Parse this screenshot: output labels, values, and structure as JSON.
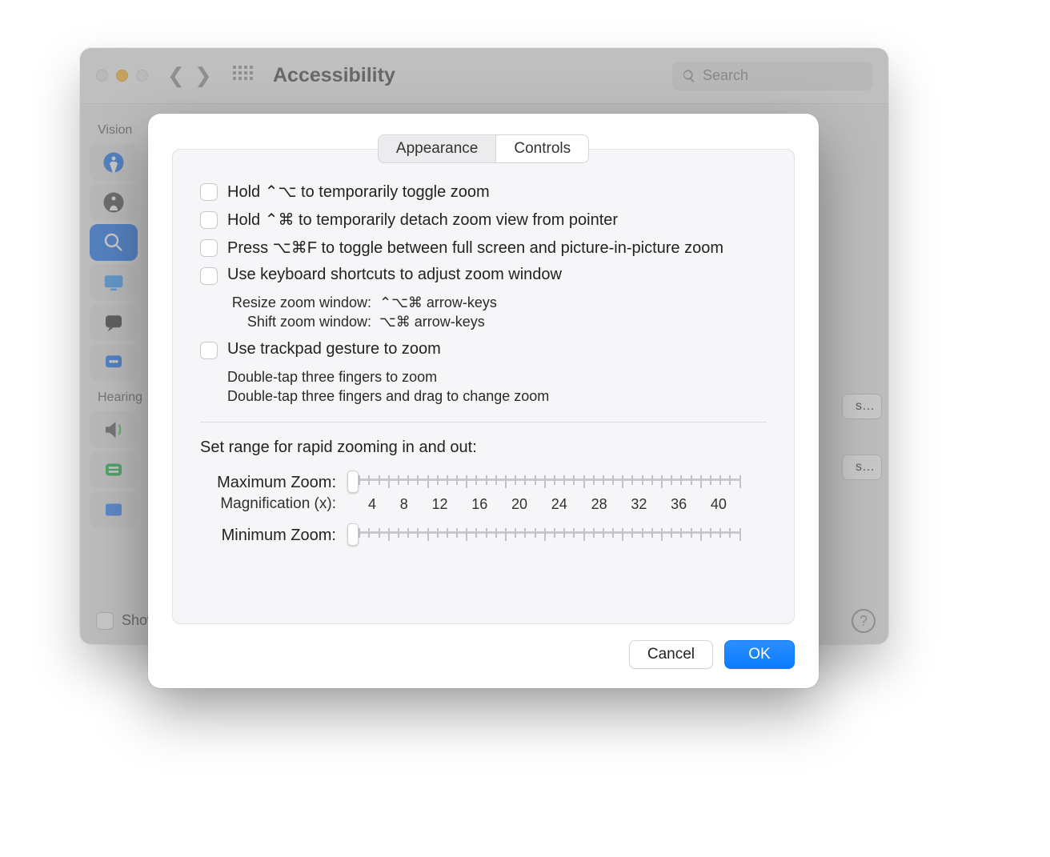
{
  "window": {
    "title": "Accessibility",
    "search_placeholder": "Search"
  },
  "sidebar": {
    "vision_label": "Vision",
    "hearing_label": "Hearing",
    "show_label": "Show"
  },
  "bg_buttons": {
    "ellipsis1": "s…",
    "ellipsis2": "s…"
  },
  "help_label": "?",
  "tabs": {
    "appearance": "Appearance",
    "controls": "Controls"
  },
  "options": {
    "hold_toggle": {
      "label": "Hold ⌃⌥ to temporarily toggle zoom"
    },
    "hold_detach": {
      "label": "Hold ⌃⌘ to temporarily detach zoom view from pointer"
    },
    "press_toggle": {
      "label": "Press ⌥⌘F to toggle between full screen and picture-in-picture zoom"
    },
    "kb_shortcuts": {
      "label": "Use keyboard shortcuts to adjust zoom window",
      "resize_k": "Resize zoom window:",
      "resize_v": "⌃⌥⌘ arrow-keys",
      "shift_k": "Shift zoom window:",
      "shift_v": "⌥⌘ arrow-keys"
    },
    "trackpad": {
      "label": "Use trackpad gesture to zoom",
      "line1": "Double-tap three fingers to zoom",
      "line2": "Double-tap three fingers and drag to change zoom"
    }
  },
  "zoom_range": {
    "title": "Set range for rapid zooming in and out:",
    "max_label": "Maximum Zoom:",
    "mag_label": "Magnification (x):",
    "min_label": "Minimum Zoom:",
    "scale": [
      "4",
      "8",
      "12",
      "16",
      "20",
      "24",
      "28",
      "32",
      "36",
      "40"
    ]
  },
  "footer": {
    "cancel": "Cancel",
    "ok": "OK"
  }
}
